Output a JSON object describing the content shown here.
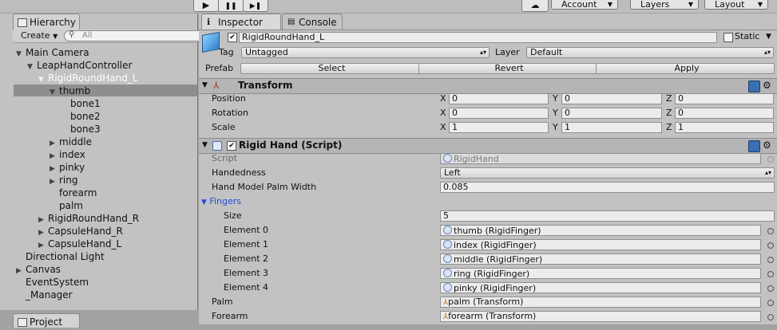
{
  "toolbar": {
    "play_icon": "▶",
    "pause_icon": "❚❚",
    "step_icon": "▶❚",
    "account_label": "Account",
    "layers_label": "Layers",
    "layout_label": "Layout"
  },
  "hierarchy": {
    "tab_label": "Hierarchy",
    "create_label": "Create",
    "search_placeholder": "All",
    "items": [
      {
        "label": "Main Camera"
      },
      {
        "label": "LeapHandController"
      },
      {
        "label": "RigidRoundHand_L"
      },
      {
        "label": "thumb"
      },
      {
        "label": "bone1"
      },
      {
        "label": "bone2"
      },
      {
        "label": "bone3"
      },
      {
        "label": "middle"
      },
      {
        "label": "index"
      },
      {
        "label": "pinky"
      },
      {
        "label": "ring"
      },
      {
        "label": "forearm"
      },
      {
        "label": "palm"
      },
      {
        "label": "RigidRoundHand_R"
      },
      {
        "label": "CapsuleHand_R"
      },
      {
        "label": "CapsuleHand_L"
      },
      {
        "label": "Directional Light"
      },
      {
        "label": "Canvas"
      },
      {
        "label": "EventSystem"
      },
      {
        "label": "_Manager"
      }
    ],
    "left_edge_label": "di"
  },
  "project_tab": {
    "label": "Project"
  },
  "inspector": {
    "tab_label": "Inspector",
    "console_tab_label": "Console",
    "object_name": "RigidRoundHand_L",
    "static_label": "Static",
    "tag_label": "Tag",
    "tag_value": "Untagged",
    "layer_label": "Layer",
    "layer_value": "Default",
    "prefab_label": "Prefab",
    "prefab_select": "Select",
    "prefab_revert": "Revert",
    "prefab_apply": "Apply",
    "transform": {
      "title": "Transform",
      "rows": [
        {
          "label": "Position",
          "x": "0",
          "y": "0",
          "z": "0"
        },
        {
          "label": "Rotation",
          "x": "0",
          "y": "0",
          "z": "0"
        },
        {
          "label": "Scale",
          "x": "1",
          "y": "1",
          "z": "1"
        }
      ],
      "axis_x": "X",
      "axis_y": "Y",
      "axis_z": "Z"
    },
    "rigid_hand": {
      "title": "Rigid Hand (Script)",
      "script_label": "Script",
      "script_value": "RigidHand",
      "handedness_label": "Handedness",
      "handedness_value": "Left",
      "palm_width_label": "Hand Model Palm Width",
      "palm_width_value": "0.085",
      "fingers_label": "Fingers",
      "size_label": "Size",
      "size_value": "5",
      "elements": [
        {
          "label": "Element 0",
          "value": "thumb (RigidFinger)"
        },
        {
          "label": "Element 1",
          "value": "index (RigidFinger)"
        },
        {
          "label": "Element 2",
          "value": "middle (RigidFinger)"
        },
        {
          "label": "Element 3",
          "value": "ring (RigidFinger)"
        },
        {
          "label": "Element 4",
          "value": "pinky (RigidFinger)"
        }
      ],
      "palm_label": "Palm",
      "palm_value": "palm (Transform)",
      "forearm_label": "Forearm",
      "forearm_value": "forearm (Transform)"
    }
  }
}
